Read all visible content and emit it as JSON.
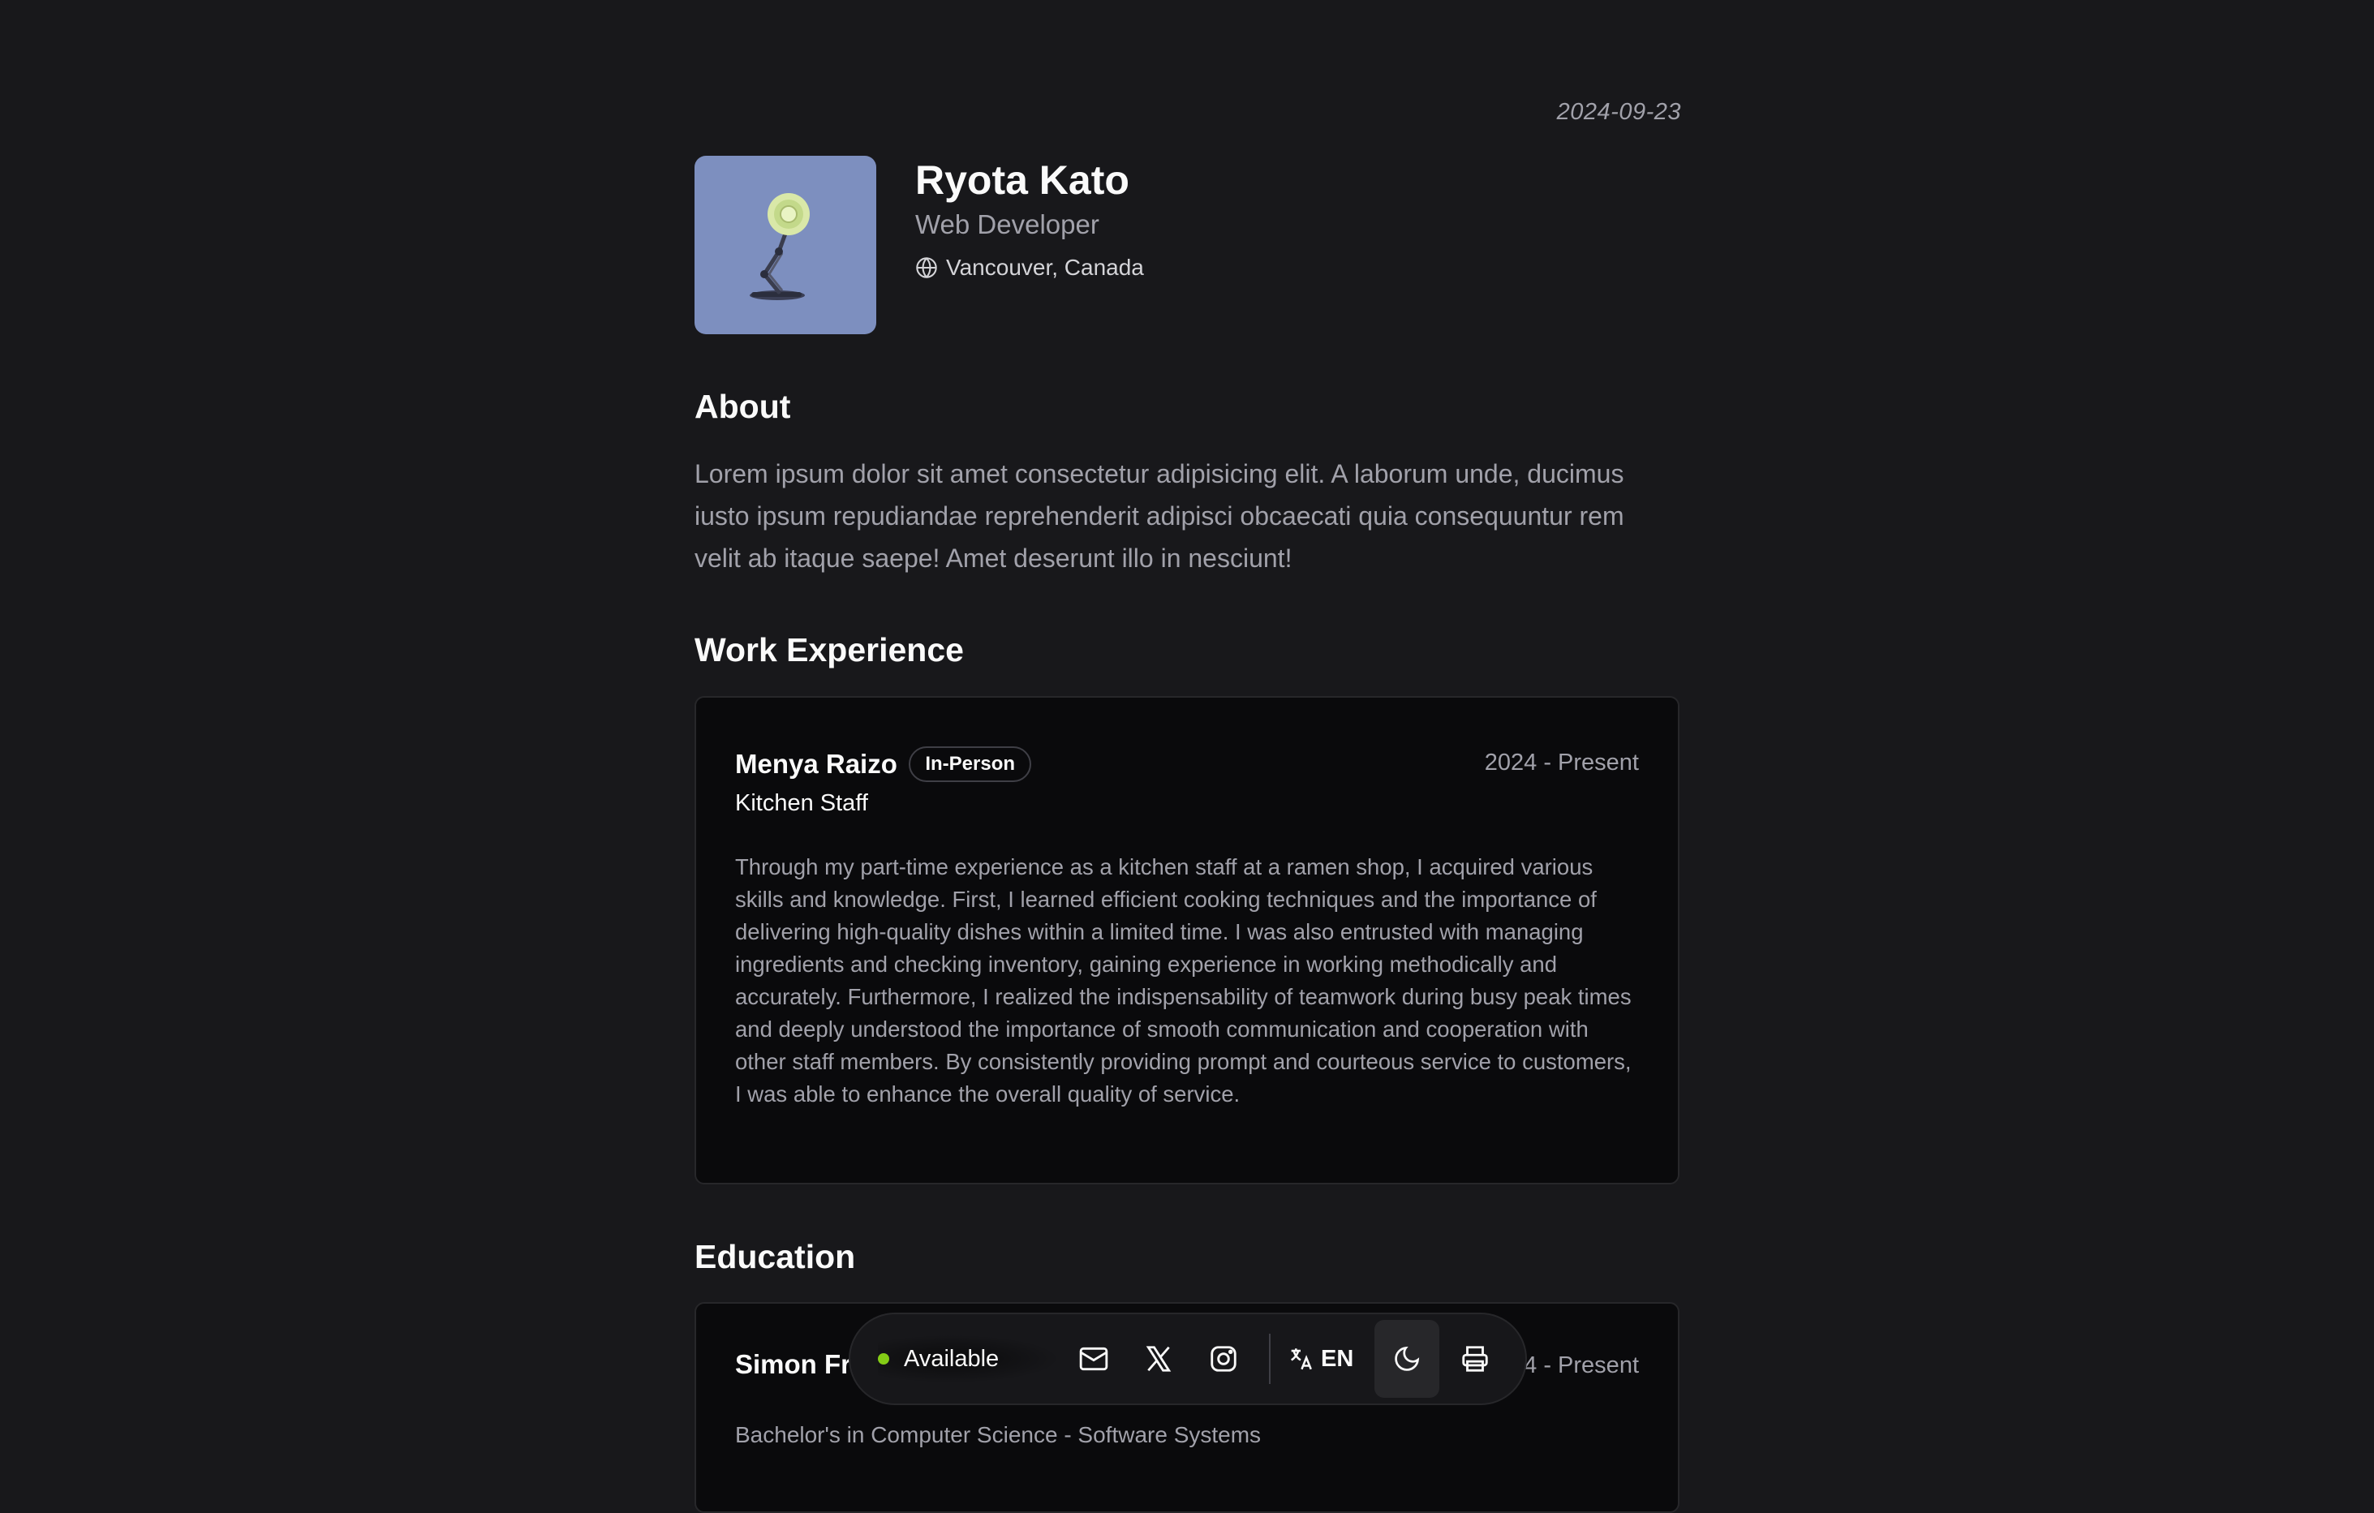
{
  "date": "2024-09-23",
  "profile": {
    "name": "Ryota Kato",
    "role": "Web Developer",
    "location": "Vancouver, Canada",
    "avatar_bg": "#7d8fbf"
  },
  "about": {
    "title": "About",
    "text": "Lorem ipsum dolor sit amet consectetur adipisicing elit. A laborum unde, ducimus iusto ipsum repudiandae reprehenderit adipisci obcaecati quia consequuntur rem velit ab itaque saepe! Amet deserunt illo in nesciunt!"
  },
  "work": {
    "title": "Work Experience",
    "items": [
      {
        "company": "Menya Raizo",
        "badge": "In-Person",
        "start": "2024",
        "end": "Present",
        "position": "Kitchen Staff",
        "description": "Through my part-time experience as a kitchen staff at a ramen shop, I acquired various skills and knowledge. First, I learned efficient cooking techniques and the importance of delivering high-quality dishes within a limited time. I was also entrusted with managing ingredients and checking inventory, gaining experience in working methodically and accurately. Furthermore, I realized the indispensability of teamwork during busy peak times and deeply understood the importance of smooth communication and cooperation with other staff members. By consistently providing prompt and courteous service to customers, I was able to enhance the overall quality of service."
      }
    ]
  },
  "education": {
    "title": "Education",
    "items": [
      {
        "school_visible": "Simon Fr",
        "period_visible": "4 - Present",
        "degree": "Bachelor's in Computer Science - Software Systems"
      }
    ]
  },
  "dock": {
    "status": "Available",
    "status_color": "#84cc16",
    "icons": [
      "mail-icon",
      "x-icon",
      "instagram-icon",
      "translate-icon",
      "moon-icon",
      "printer-icon"
    ],
    "language": "EN"
  }
}
